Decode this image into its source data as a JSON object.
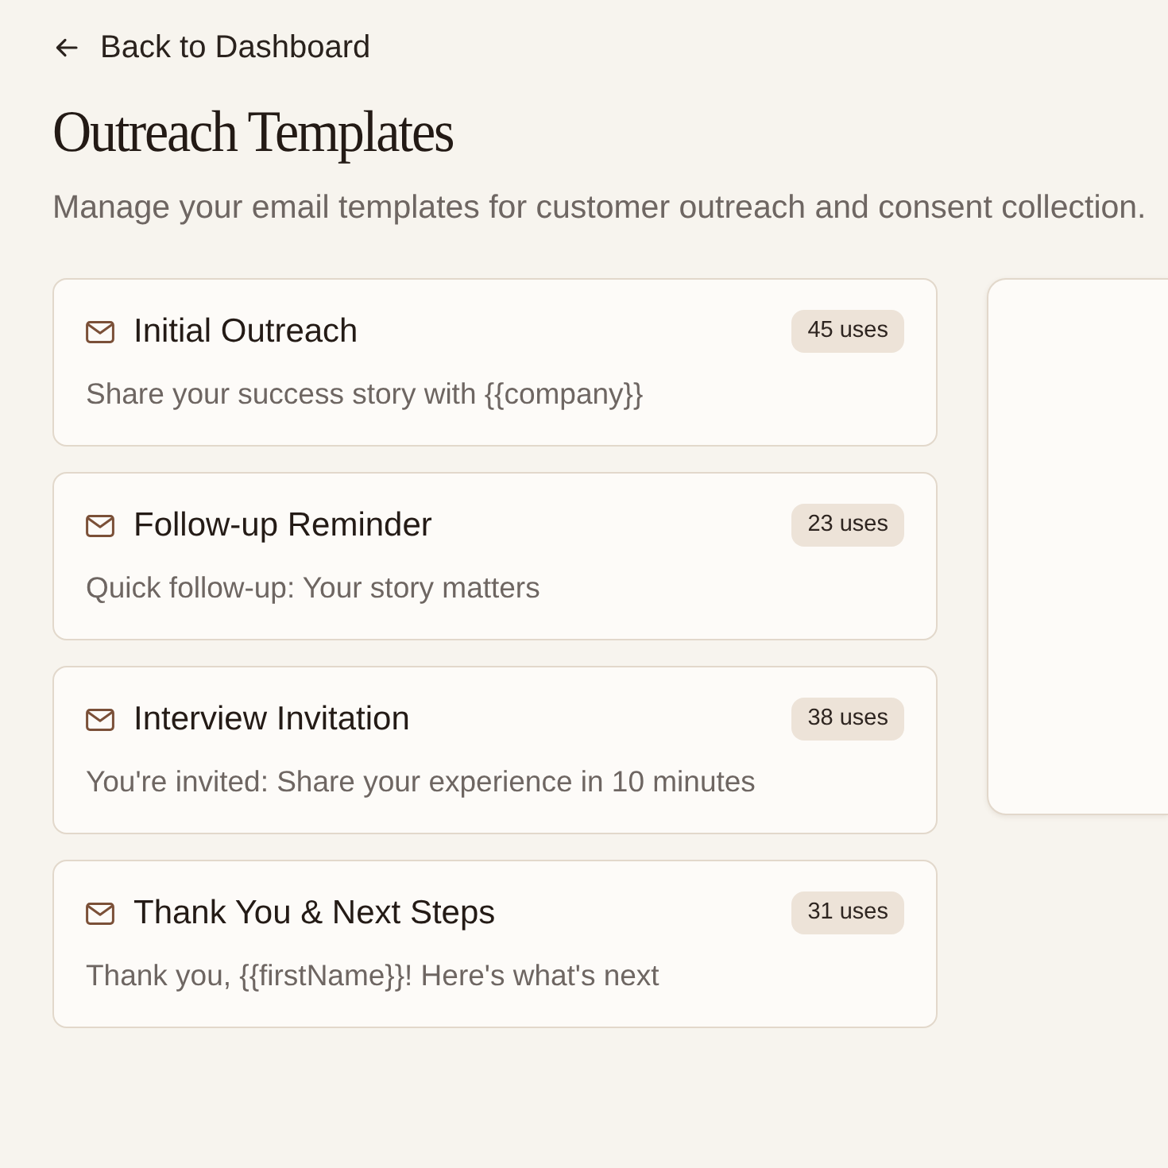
{
  "back_link": {
    "label": "Back to Dashboard"
  },
  "page": {
    "title": "Outreach Templates",
    "subtitle": "Manage your email templates for customer outreach and consent collection."
  },
  "templates": [
    {
      "name": "Initial Outreach",
      "uses": "45 uses",
      "subject": "Share your success story with {{company}}"
    },
    {
      "name": "Follow-up Reminder",
      "uses": "23 uses",
      "subject": "Quick follow-up: Your story matters"
    },
    {
      "name": "Interview Invitation",
      "uses": "38 uses",
      "subject": "You're invited: Share your experience in 10 minutes"
    },
    {
      "name": "Thank You & Next Steps",
      "uses": "31 uses",
      "subject": "Thank you, {{firstName}}! Here's what's next"
    }
  ]
}
